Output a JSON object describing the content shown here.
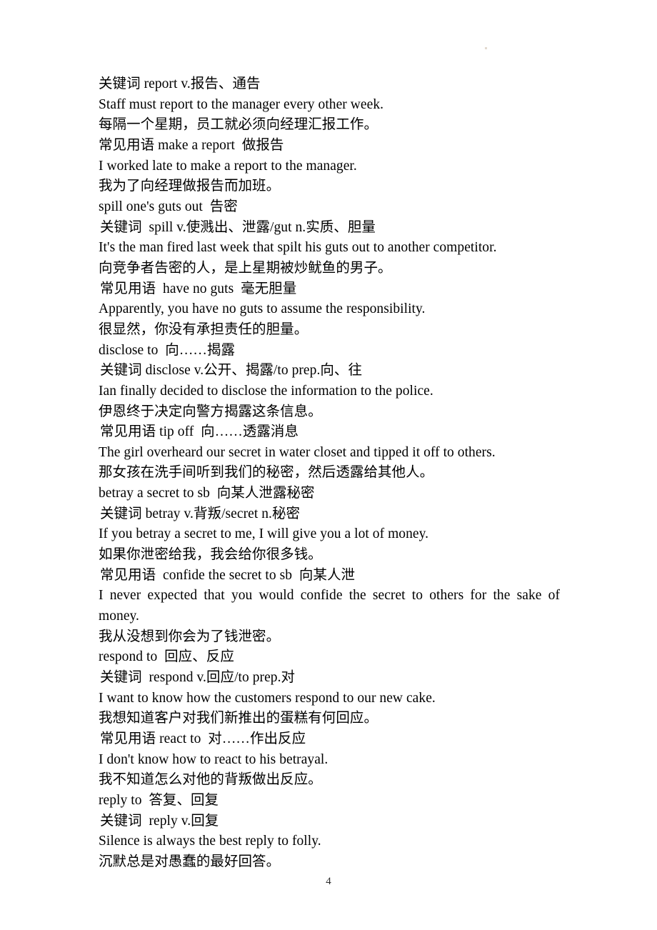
{
  "document": {
    "page_number": "4",
    "lines": [
      {
        "text": "关键词 report v.报告、通告",
        "indent": false,
        "justified": false
      },
      {
        "text": "Staff must report to the manager every other week.",
        "indent": false,
        "justified": false
      },
      {
        "text": "每隔一个星期，员工就必须向经理汇报工作。",
        "indent": false,
        "justified": false
      },
      {
        "text": "常见用语 make a report  做报告",
        "indent": false,
        "justified": false
      },
      {
        "text": "I worked late to make a report to the manager.",
        "indent": false,
        "justified": false
      },
      {
        "text": "我为了向经理做报告而加班。",
        "indent": false,
        "justified": false
      },
      {
        "text": "spill one's guts out  告密",
        "indent": false,
        "justified": false
      },
      {
        "text": "关键词  spill v.使溅出、泄露/gut n.实质、胆量",
        "indent": true,
        "justified": false
      },
      {
        "text": "It's the man fired last week that spilt his guts out to another competitor.",
        "indent": false,
        "justified": false
      },
      {
        "text": "向竞争者告密的人，是上星期被炒鱿鱼的男子。",
        "indent": false,
        "justified": false
      },
      {
        "text": "常见用语  have no guts  毫无胆量",
        "indent": true,
        "justified": false
      },
      {
        "text": "Apparently, you have no guts to assume the responsibility.",
        "indent": false,
        "justified": false
      },
      {
        "text": "很显然，你没有承担责任的胆量。",
        "indent": false,
        "justified": false
      },
      {
        "text": "disclose to  向……揭露",
        "indent": false,
        "justified": false
      },
      {
        "text": "关键词 disclose v.公开、揭露/to prep.向、往",
        "indent": true,
        "justified": false
      },
      {
        "text": "Ian finally decided to disclose the information to the police.",
        "indent": false,
        "justified": false
      },
      {
        "text": "伊恩终于决定向警方揭露这条信息。",
        "indent": false,
        "justified": false
      },
      {
        "text": "常见用语 tip off  向……透露消息",
        "indent": true,
        "justified": false
      },
      {
        "text": "The girl overheard our secret in water closet and tipped it off to others.",
        "indent": false,
        "justified": false
      },
      {
        "text": "那女孩在洗手间听到我们的秘密，然后透露给其他人。",
        "indent": false,
        "justified": false
      },
      {
        "text": "betray a secret to sb  向某人泄露秘密",
        "indent": false,
        "justified": false
      },
      {
        "text": "关键词 betray v.背叛/secret n.秘密",
        "indent": true,
        "justified": false
      },
      {
        "text": "If you betray a secret to me, I will give you a lot of money.",
        "indent": false,
        "justified": false
      },
      {
        "text": "如果你泄密给我，我会给你很多钱。",
        "indent": false,
        "justified": false
      },
      {
        "text": "常见用语  confide the secret to sb  向某人泄",
        "indent": true,
        "justified": false
      },
      {
        "text": "I never expected that you would confide the secret to others for the sake of money.",
        "indent": false,
        "justified": true
      },
      {
        "text": "我从没想到你会为了钱泄密。",
        "indent": false,
        "justified": false
      },
      {
        "text": "respond to  回应、反应",
        "indent": false,
        "justified": false
      },
      {
        "text": "关键词  respond v.回应/to prep.对",
        "indent": true,
        "justified": false
      },
      {
        "text": "I want to know how the customers respond to our new cake.",
        "indent": false,
        "justified": false
      },
      {
        "text": "我想知道客户对我们新推出的蛋糕有何回应。",
        "indent": false,
        "justified": false
      },
      {
        "text": "常见用语 react to  对……作出反应",
        "indent": true,
        "justified": false
      },
      {
        "text": "I don't know how to react to his betrayal.",
        "indent": false,
        "justified": false
      },
      {
        "text": "我不知道怎么对他的背叛做出反应。",
        "indent": false,
        "justified": false
      },
      {
        "text": "reply to  答复、回复",
        "indent": false,
        "justified": false
      },
      {
        "text": "关键词  reply v.回复",
        "indent": true,
        "justified": false
      },
      {
        "text": "Silence is always the best reply to folly.",
        "indent": false,
        "justified": false
      },
      {
        "text": "沉默总是对愚蠢的最好回答。",
        "indent": false,
        "justified": false
      }
    ]
  }
}
